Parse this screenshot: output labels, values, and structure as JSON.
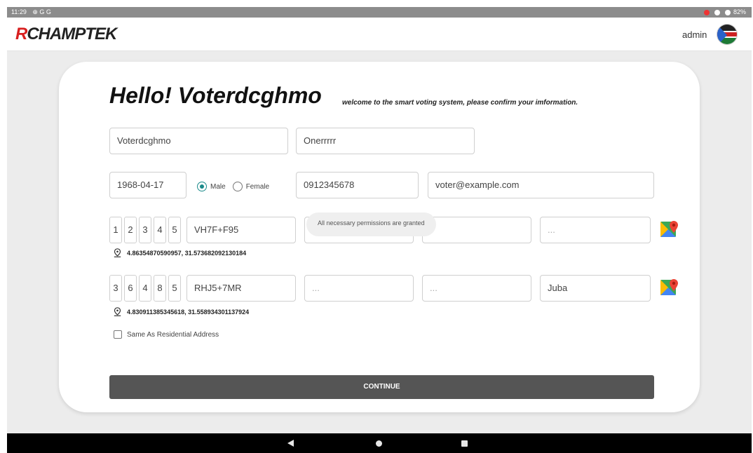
{
  "status_bar": {
    "time": "11:29",
    "left_glyphs": "⊕ G G",
    "battery": "82%"
  },
  "app_bar": {
    "logo_text": "RCHAMPTEK",
    "logo_first_letter": "R",
    "logo_rest": "CHAMPTEK",
    "user_label": "admin",
    "avatar_icon": "south-sudan-flag"
  },
  "greeting": {
    "title": "Hello! Voterdcghmo",
    "subtitle": "welcome to the smart voting system, please confirm your imformation."
  },
  "personal": {
    "first_name": "Voterdcghmo",
    "last_name": "Onerrrrr",
    "birth_date": "1968-04-17",
    "gender_options": [
      {
        "label": "Male",
        "selected": true
      },
      {
        "label": "Female",
        "selected": false
      }
    ],
    "phone": "0912345678",
    "email": "voter@example.com"
  },
  "residential_address": {
    "digits": [
      "1",
      "2",
      "3",
      "4",
      "5"
    ],
    "plus_code": "VH7F+F95",
    "field_2": "...",
    "field_3": "",
    "field_4": "...",
    "coordinates": "4.86354870590957, 31.573682092130184",
    "map_icon": "google-maps-icon"
  },
  "toast": {
    "message": "All necessary permissions are granted"
  },
  "birth_address": {
    "digits": [
      "3",
      "6",
      "4",
      "8",
      "5"
    ],
    "plus_code": "RHJ5+7MR",
    "field_2": "...",
    "field_3": "...",
    "field_4": "Juba",
    "coordinates": "4.830911385345618, 31.558934301137924",
    "map_icon": "google-maps-icon"
  },
  "same_as_residential": {
    "label": "Same As Residential Address",
    "checked": false
  },
  "continue_button": {
    "label": "CONTINUE"
  },
  "colors": {
    "accent": "#1a8a8a",
    "logo_red": "#d82020",
    "button": "#555555"
  }
}
